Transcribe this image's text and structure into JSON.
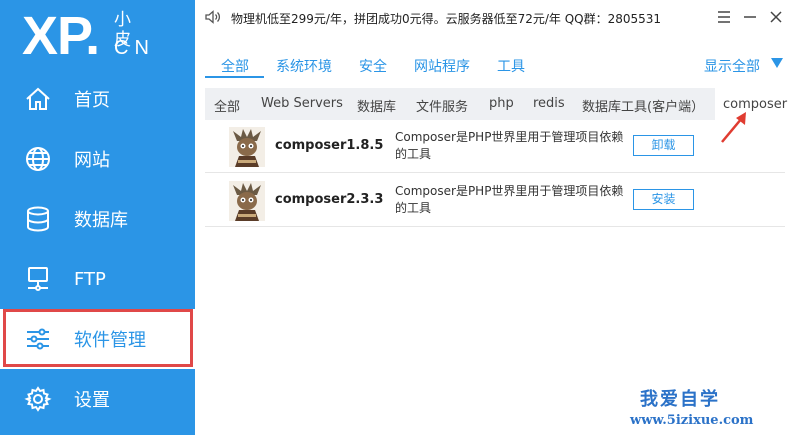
{
  "logo": {
    "main": "XP.",
    "top": "小皮",
    "bottom": "CN"
  },
  "sidebar": {
    "items": [
      {
        "label": "首页",
        "icon": "home-icon"
      },
      {
        "label": "网站",
        "icon": "globe-icon"
      },
      {
        "label": "数据库",
        "icon": "database-icon"
      },
      {
        "label": "FTP",
        "icon": "ftp-icon"
      },
      {
        "label": "软件管理",
        "icon": "sliders-icon"
      },
      {
        "label": "设置",
        "icon": "gear-icon"
      }
    ],
    "active_index": 4
  },
  "topbar": {
    "notice": "物理机低至299元/年，拼团成功0元得。云服务器低至72元/年 QQ群：2805531"
  },
  "tabs1": {
    "items": [
      "全部",
      "系统环境",
      "安全",
      "网站程序",
      "工具"
    ],
    "active_index": 0,
    "show_all": "显示全部"
  },
  "tabs2": {
    "items": [
      "全部",
      "Web Servers",
      "数据库",
      "文件服务",
      "php",
      "redis",
      "数据库工具(客户端）",
      "composer"
    ],
    "active_index": 7
  },
  "software": [
    {
      "name": "composer1.8.5",
      "desc": "Composer是PHP世界里用于管理项目依赖的工具",
      "action": "卸载"
    },
    {
      "name": "composer2.3.3",
      "desc": "Composer是PHP世界里用于管理项目依赖的工具",
      "action": "安装"
    }
  ],
  "watermark": {
    "line1": "我爱自学",
    "line2": "www.5izixue.com"
  },
  "colors": {
    "accent": "#2b95e6",
    "highlight": "#e04848"
  }
}
